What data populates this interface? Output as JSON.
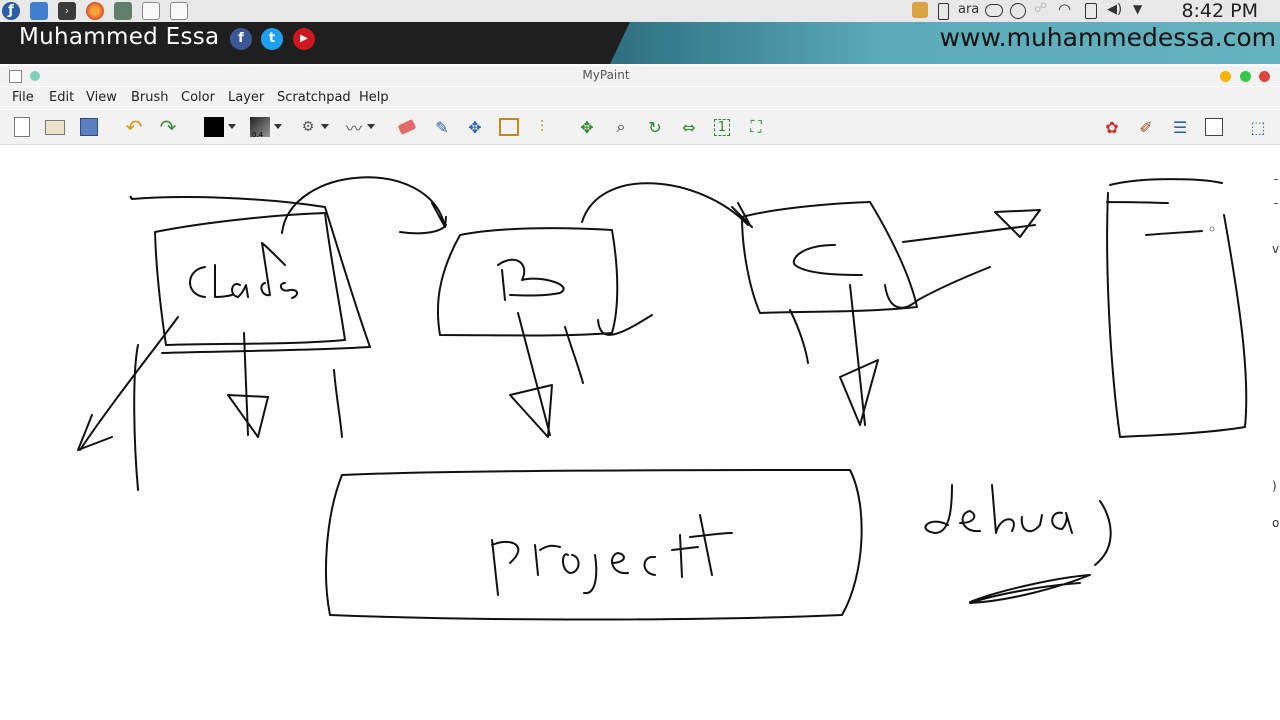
{
  "presenter": {
    "name": "Muhammed Essa",
    "social": [
      "f",
      "t",
      "▶"
    ],
    "url": "www.muhammedessa.com"
  },
  "system": {
    "keyboard_layout": "ara",
    "clock": "8:42 PM"
  },
  "window": {
    "title": "MyPaint"
  },
  "menu": [
    "File",
    "Edit",
    "View",
    "Brush",
    "Color",
    "Layer",
    "Scratchpad",
    "Help"
  ],
  "toolbar": {
    "brush_size_label": "0.4",
    "view_reset_label": "1",
    "color_swatch": "#000000"
  },
  "colors": {
    "banner_dark": "#1f1f1f",
    "banner_teal": "#5aaab8",
    "ink": "#111111",
    "win_min": "#f4b400",
    "win_max": "#34c84a",
    "win_close": "#e0443e"
  },
  "icons": {
    "launchers": [
      "fedora-icon",
      "file-manager-icon",
      "terminal-icon",
      "firefox-icon",
      "image-viewer-icon",
      "screenshot-icon",
      "mypaint-icon"
    ],
    "tray": [
      "package-icon",
      "battery-icon",
      "cloud-icon",
      "update-icon",
      "network-icon",
      "wifi-icon",
      "clipboard-icon",
      "volume-icon",
      "dropdown-icon"
    ]
  }
}
